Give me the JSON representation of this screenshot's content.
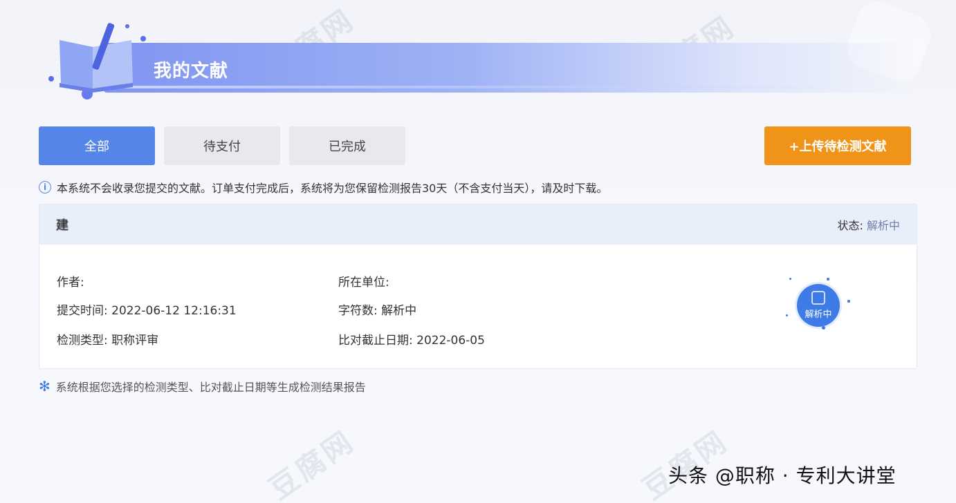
{
  "banner": {
    "title": "我的文献"
  },
  "tabs": [
    {
      "label": "全部",
      "active": true
    },
    {
      "label": "待支付",
      "active": false
    },
    {
      "label": "已完成",
      "active": false
    }
  ],
  "upload_button": {
    "label": "+上传待检测文献"
  },
  "notice": {
    "icon": "info-icon",
    "text": "本系统不会收录您提交的文献。订单支付完成后，系统将为您保留检测报告30天（不含支付当天），请及时下载。"
  },
  "record": {
    "title": "建",
    "status_label": "状态:",
    "status_value": "解析中",
    "author_label": "作者:",
    "author_value": "",
    "unit_label": "所在单位:",
    "unit_value": "",
    "submit_time_label": "提交时间:",
    "submit_time_value": "2022-06-12 12:16:31",
    "char_count_label": "字符数:",
    "char_count_value": "解析中",
    "detect_type_label": "检测类型:",
    "detect_type_value": "职称评审",
    "cutoff_label": "比对截止日期:",
    "cutoff_value": "2022-06-05",
    "badge_text": "解析中"
  },
  "footnote": {
    "icon": "snowflake-icon",
    "text": "系统根据您选择的检测类型、比对截止日期等生成检测结果报告"
  },
  "credit": "头条 @职称 · 专利大讲堂",
  "colors": {
    "primary": "#5585e8",
    "upload": "#ef9418",
    "badge": "#3f7be6"
  }
}
